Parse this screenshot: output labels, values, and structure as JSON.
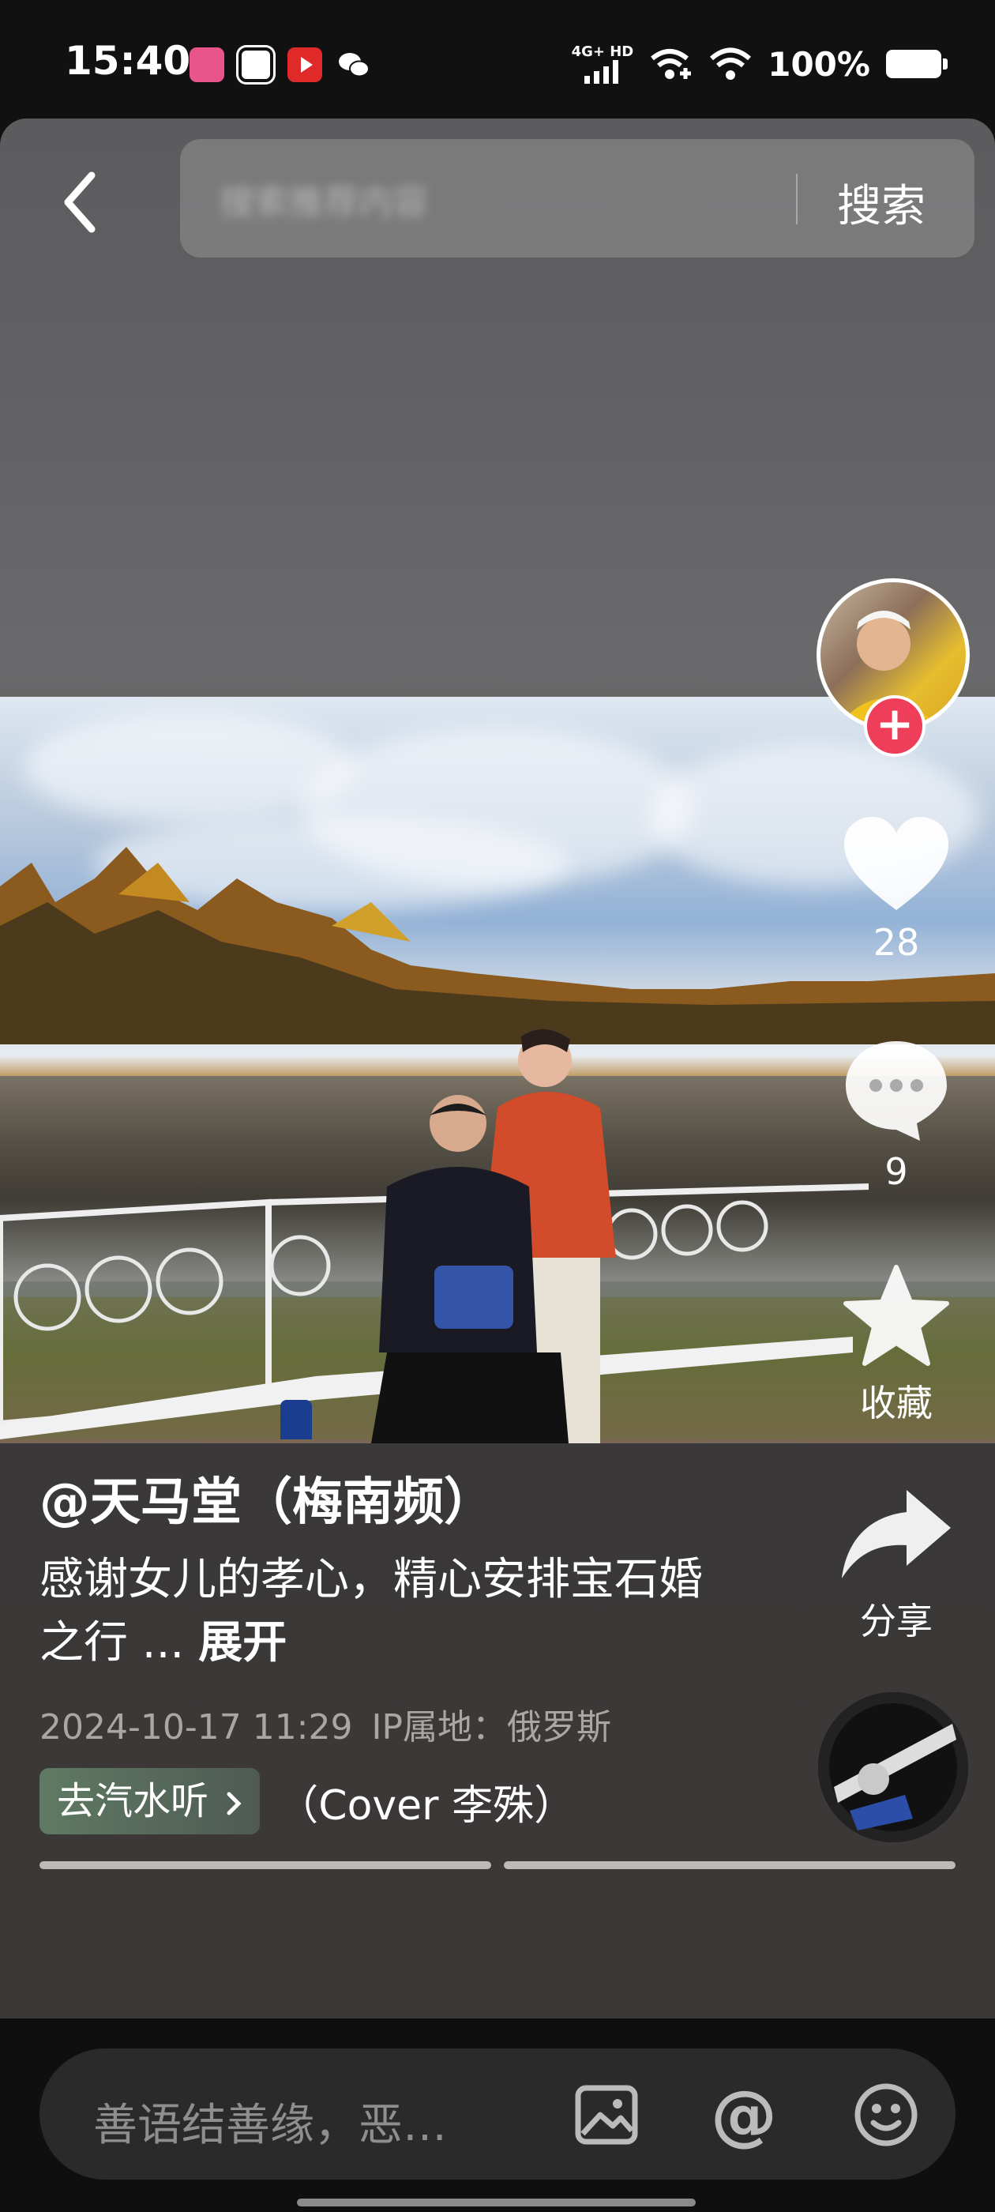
{
  "status_bar": {
    "time": "15:40",
    "network_label": "4G+ HD",
    "battery": "100%",
    "icons": [
      "bilibili-app-icon",
      "hand-app-icon",
      "play-app-icon",
      "wechat-icon",
      "signal-icon",
      "wifi-plus-icon",
      "wifi-icon",
      "battery-icon"
    ]
  },
  "header": {
    "back_icon": "chevron-left-icon",
    "search_placeholder": "搜索推荐内容",
    "search_button": "搜索"
  },
  "side_actions": {
    "likes": "28",
    "comments": "9",
    "collect_label": "收藏",
    "share_label": "分享",
    "follow_icon": "plus-icon"
  },
  "post": {
    "author": "@天马堂（梅南频）",
    "description": "感谢女儿的孝心，精心安排宝石婚之行 ...",
    "expand_label": "展开",
    "date": "2024-10-17 11:29",
    "ip_location": "IP属地：俄罗斯",
    "music_tag": "去汽水听",
    "music_name": "（Cover 李殊）"
  },
  "comment_bar": {
    "placeholder": "善语结善缘，恶…",
    "at_symbol": "@",
    "icons": [
      "image-icon",
      "at-icon",
      "emoji-icon"
    ]
  },
  "colors": {
    "follow": "#ef3e59",
    "background": "#3b3837",
    "bottom_bar": "#0f0f0f"
  }
}
